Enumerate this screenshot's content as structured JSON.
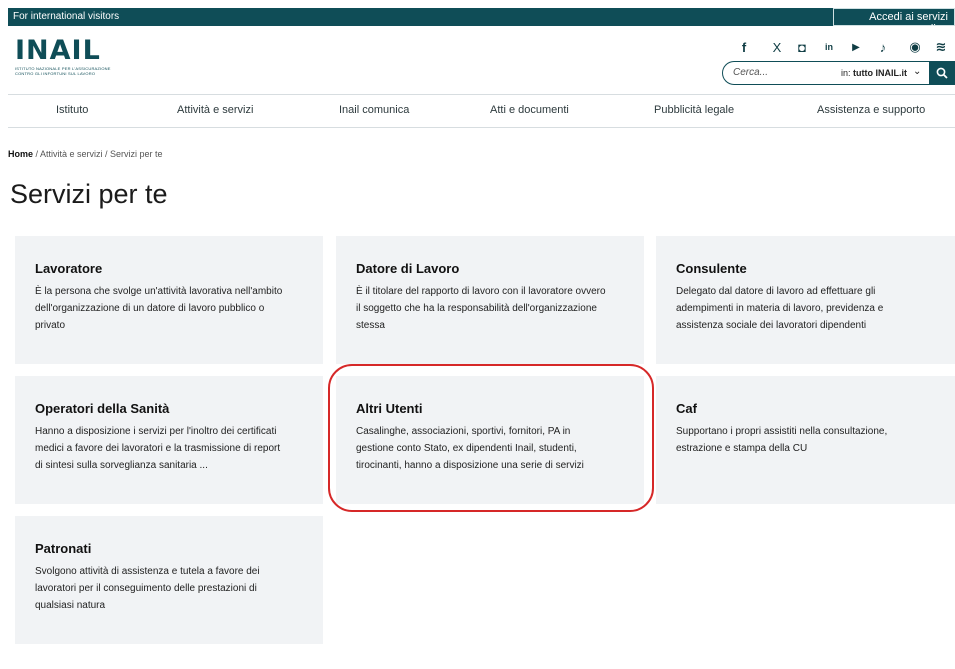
{
  "topbar": {
    "international": "For international visitors",
    "accedi": "Accedi ai servizi online"
  },
  "logo": {
    "text": "INAIL",
    "subtitle_line1": "ISTITUTO NAZIONALE PER L'ASSICURAZIONE",
    "subtitle_line2": "CONTRO GLI INFORTUNI SUL LAVORO"
  },
  "social": [
    {
      "icon": "facebook-icon",
      "glyph": "f"
    },
    {
      "icon": "x-icon",
      "glyph": "X"
    },
    {
      "icon": "instagram-icon",
      "glyph": "◘"
    },
    {
      "icon": "linkedin-icon",
      "glyph": "in"
    },
    {
      "icon": "youtube-icon",
      "glyph": "▶"
    },
    {
      "icon": "tiktok-icon",
      "glyph": "♪"
    },
    {
      "icon": "podcast-icon",
      "glyph": "◉"
    },
    {
      "icon": "rss-icon",
      "glyph": "≋"
    }
  ],
  "search": {
    "placeholder": "Cerca...",
    "scope_prefix": "in:",
    "scope_value": "tutto INAIL.it"
  },
  "nav": {
    "items": [
      "Istituto",
      "Attività e servizi",
      "Inail comunica",
      "Atti e documenti",
      "Pubblicità legale",
      "Assistenza e supporto"
    ]
  },
  "breadcrumb": {
    "home": "Home",
    "rest": " / Attività e servizi / Servizi per te"
  },
  "page_title": "Servizi per te",
  "cards": [
    {
      "title": "Lavoratore",
      "lines": [
        "È la persona che svolge un'attività lavorativa nell'ambito",
        "dell'organizzazione di un datore di lavoro pubblico o",
        "privato"
      ]
    },
    {
      "title": "Datore di Lavoro",
      "lines": [
        "È il titolare del rapporto di lavoro con il lavoratore ovvero",
        "il soggetto che ha la responsabilità dell'organizzazione",
        "stessa"
      ]
    },
    {
      "title": "Consulente",
      "lines": [
        "Delegato dal datore di lavoro ad effettuare gli",
        "adempimenti in materia di lavoro, previdenza e",
        "assistenza sociale dei lavoratori dipendenti"
      ]
    },
    {
      "title": "Operatori della Sanità",
      "lines": [
        "Hanno a disposizione i servizi per l'inoltro dei certificati",
        "medici a favore dei lavoratori e la trasmissione di report",
        "di sintesi sulla sorveglianza sanitaria ..."
      ]
    },
    {
      "title": "Altri Utenti",
      "lines": [
        "Casalinghe, associazioni, sportivi, fornitori, PA in",
        "gestione conto Stato, ex dipendenti Inail, studenti,",
        "tirocinanti, hanno a disposizione una serie di servizi"
      ]
    },
    {
      "title": "Caf",
      "lines": [
        "Supportano i propri assistiti nella consultazione,",
        "estrazione e stampa della CU"
      ]
    },
    {
      "title": "Patronati",
      "lines": [
        "Svolgono attività di assistenza e tutela a favore dei",
        "lavoratori per il conseguimento delle prestazioni di",
        "qualsiasi natura"
      ]
    }
  ],
  "colors": {
    "brand": "#0f4d57",
    "card_bg": "#f1f3f5",
    "highlight": "#d62828"
  }
}
